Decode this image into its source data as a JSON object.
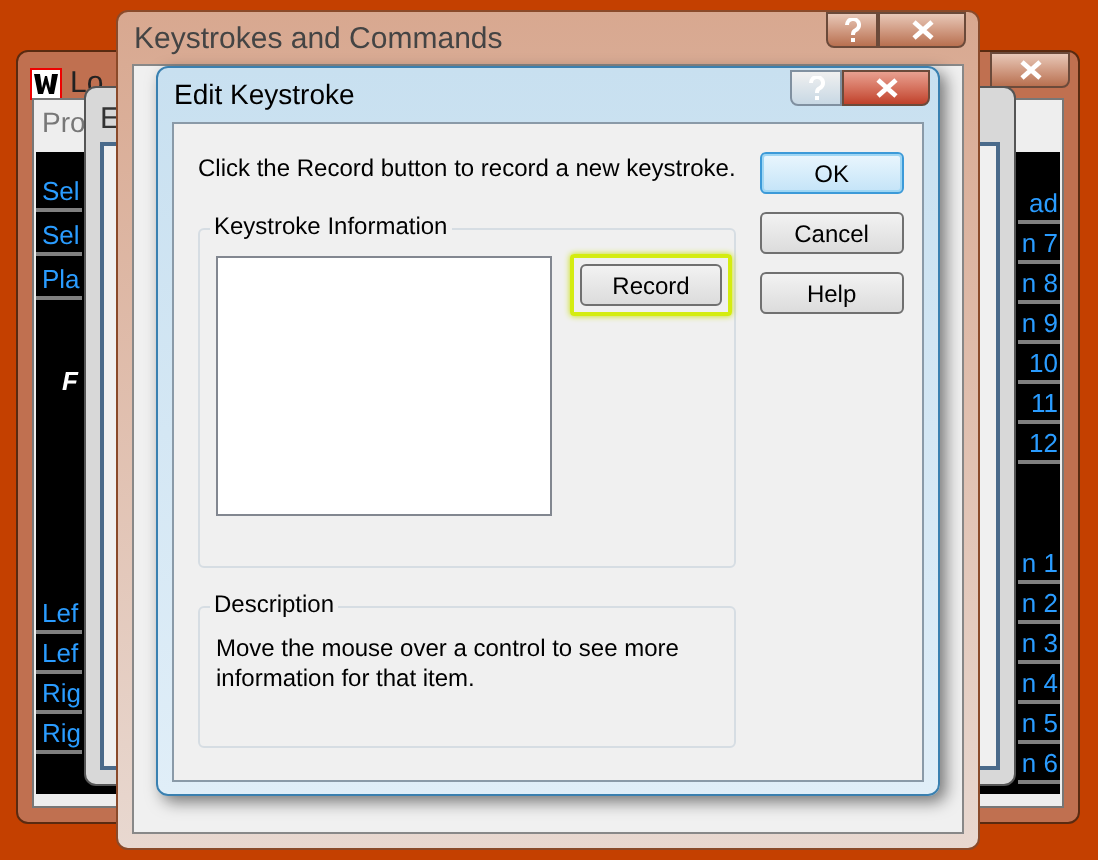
{
  "back_window": {
    "title": "Lo",
    "tab": "Pro",
    "heading": "F",
    "left_top_items": [
      "Sel",
      "Sel",
      "Pla"
    ],
    "left_bottom_items": [
      "Lef",
      "Lef",
      "Rig",
      "Rig"
    ],
    "right_top_items": [
      "ad",
      "n 7",
      "n 8",
      "n 9",
      "10",
      "11",
      "12"
    ],
    "right_bottom_items": [
      "n 1",
      "n 2",
      "n 3",
      "n 4",
      "n 5",
      "n 6"
    ]
  },
  "middle_window": {
    "title": "E"
  },
  "keystrokes_window": {
    "title": "Keystrokes and Commands"
  },
  "dialog": {
    "title": "Edit Keystroke",
    "instruction": "Click the Record button to record a new keystroke.",
    "buttons": [
      {
        "label": "OK",
        "default": true
      },
      {
        "label": "Cancel",
        "default": false
      },
      {
        "label": "Help",
        "default": false
      }
    ],
    "keystroke_group": {
      "label": "Keystroke Information",
      "record_button": {
        "label": "Record",
        "highlighted": true
      }
    },
    "description_group": {
      "label": "Description",
      "text": "Move the mouse over a control to see more information for that item."
    }
  }
}
